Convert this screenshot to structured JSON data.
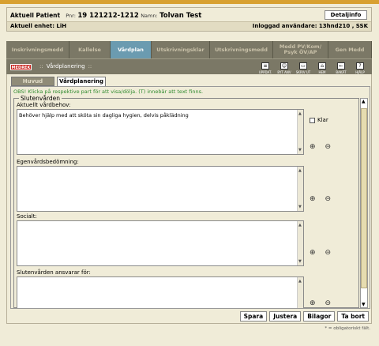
{
  "patient": {
    "label": "Aktuell Patient",
    "pnr_label": "Pnr:",
    "pnr": "19 121212-1212",
    "name_label": "Namn:",
    "name": "Tolvan Test",
    "detail_button": "Detaljinfo",
    "unit_text": "Aktuell enhet: LiH",
    "logged_in_text": "Inloggad användare: 13hnd210 , SSK"
  },
  "tabs": [
    {
      "label": "Inskrivningsmedd"
    },
    {
      "label": "Kallelse"
    },
    {
      "label": "Vårdplan"
    },
    {
      "label": "Utskrivningsklar"
    },
    {
      "label": "Utskrivningsmedd"
    },
    {
      "label": "Medd PV/Kom/ Psyk ÖV/AP"
    },
    {
      "label": "Gen Medd"
    }
  ],
  "toolbar": {
    "logo": "MEDREK",
    "crumb": "Vårdplanering",
    "tools": [
      {
        "label": "UPPDAT.",
        "icon": "update-icon"
      },
      {
        "label": "BYT ANV",
        "icon": "switch-user-icon"
      },
      {
        "label": "SKRIV UT",
        "icon": "print-icon"
      },
      {
        "label": "HEM",
        "icon": "home-icon"
      },
      {
        "label": "BAKÅT",
        "icon": "back-icon"
      },
      {
        "label": "HJÄLP",
        "icon": "help-icon"
      }
    ]
  },
  "subtabs": {
    "first": "Huvud",
    "second": "Vårdplanering"
  },
  "notice": "OBS! Klicka på respektive part för att visa/dölja. (T) innebär att text finns.",
  "section_title": "Slutenvården",
  "fields": {
    "f1_label": "Aktuellt vårdbehov:",
    "f1_value": "Behöver hjälp med att sköta sin dagliga hygien, delvis påklädning",
    "f2_label": "Egenvårdsbedömning:",
    "f2_value": "",
    "f3_label": "Socialt:",
    "f3_value": "",
    "f4_label": "Slutenvården ansvarar för:",
    "f4_value": ""
  },
  "klar_label": "Klar",
  "actions": {
    "save": "Spara",
    "adjust": "Justera",
    "attachments": "Bilagor",
    "delete": "Ta bort"
  },
  "footnote": "* = obligatoriskt fält."
}
